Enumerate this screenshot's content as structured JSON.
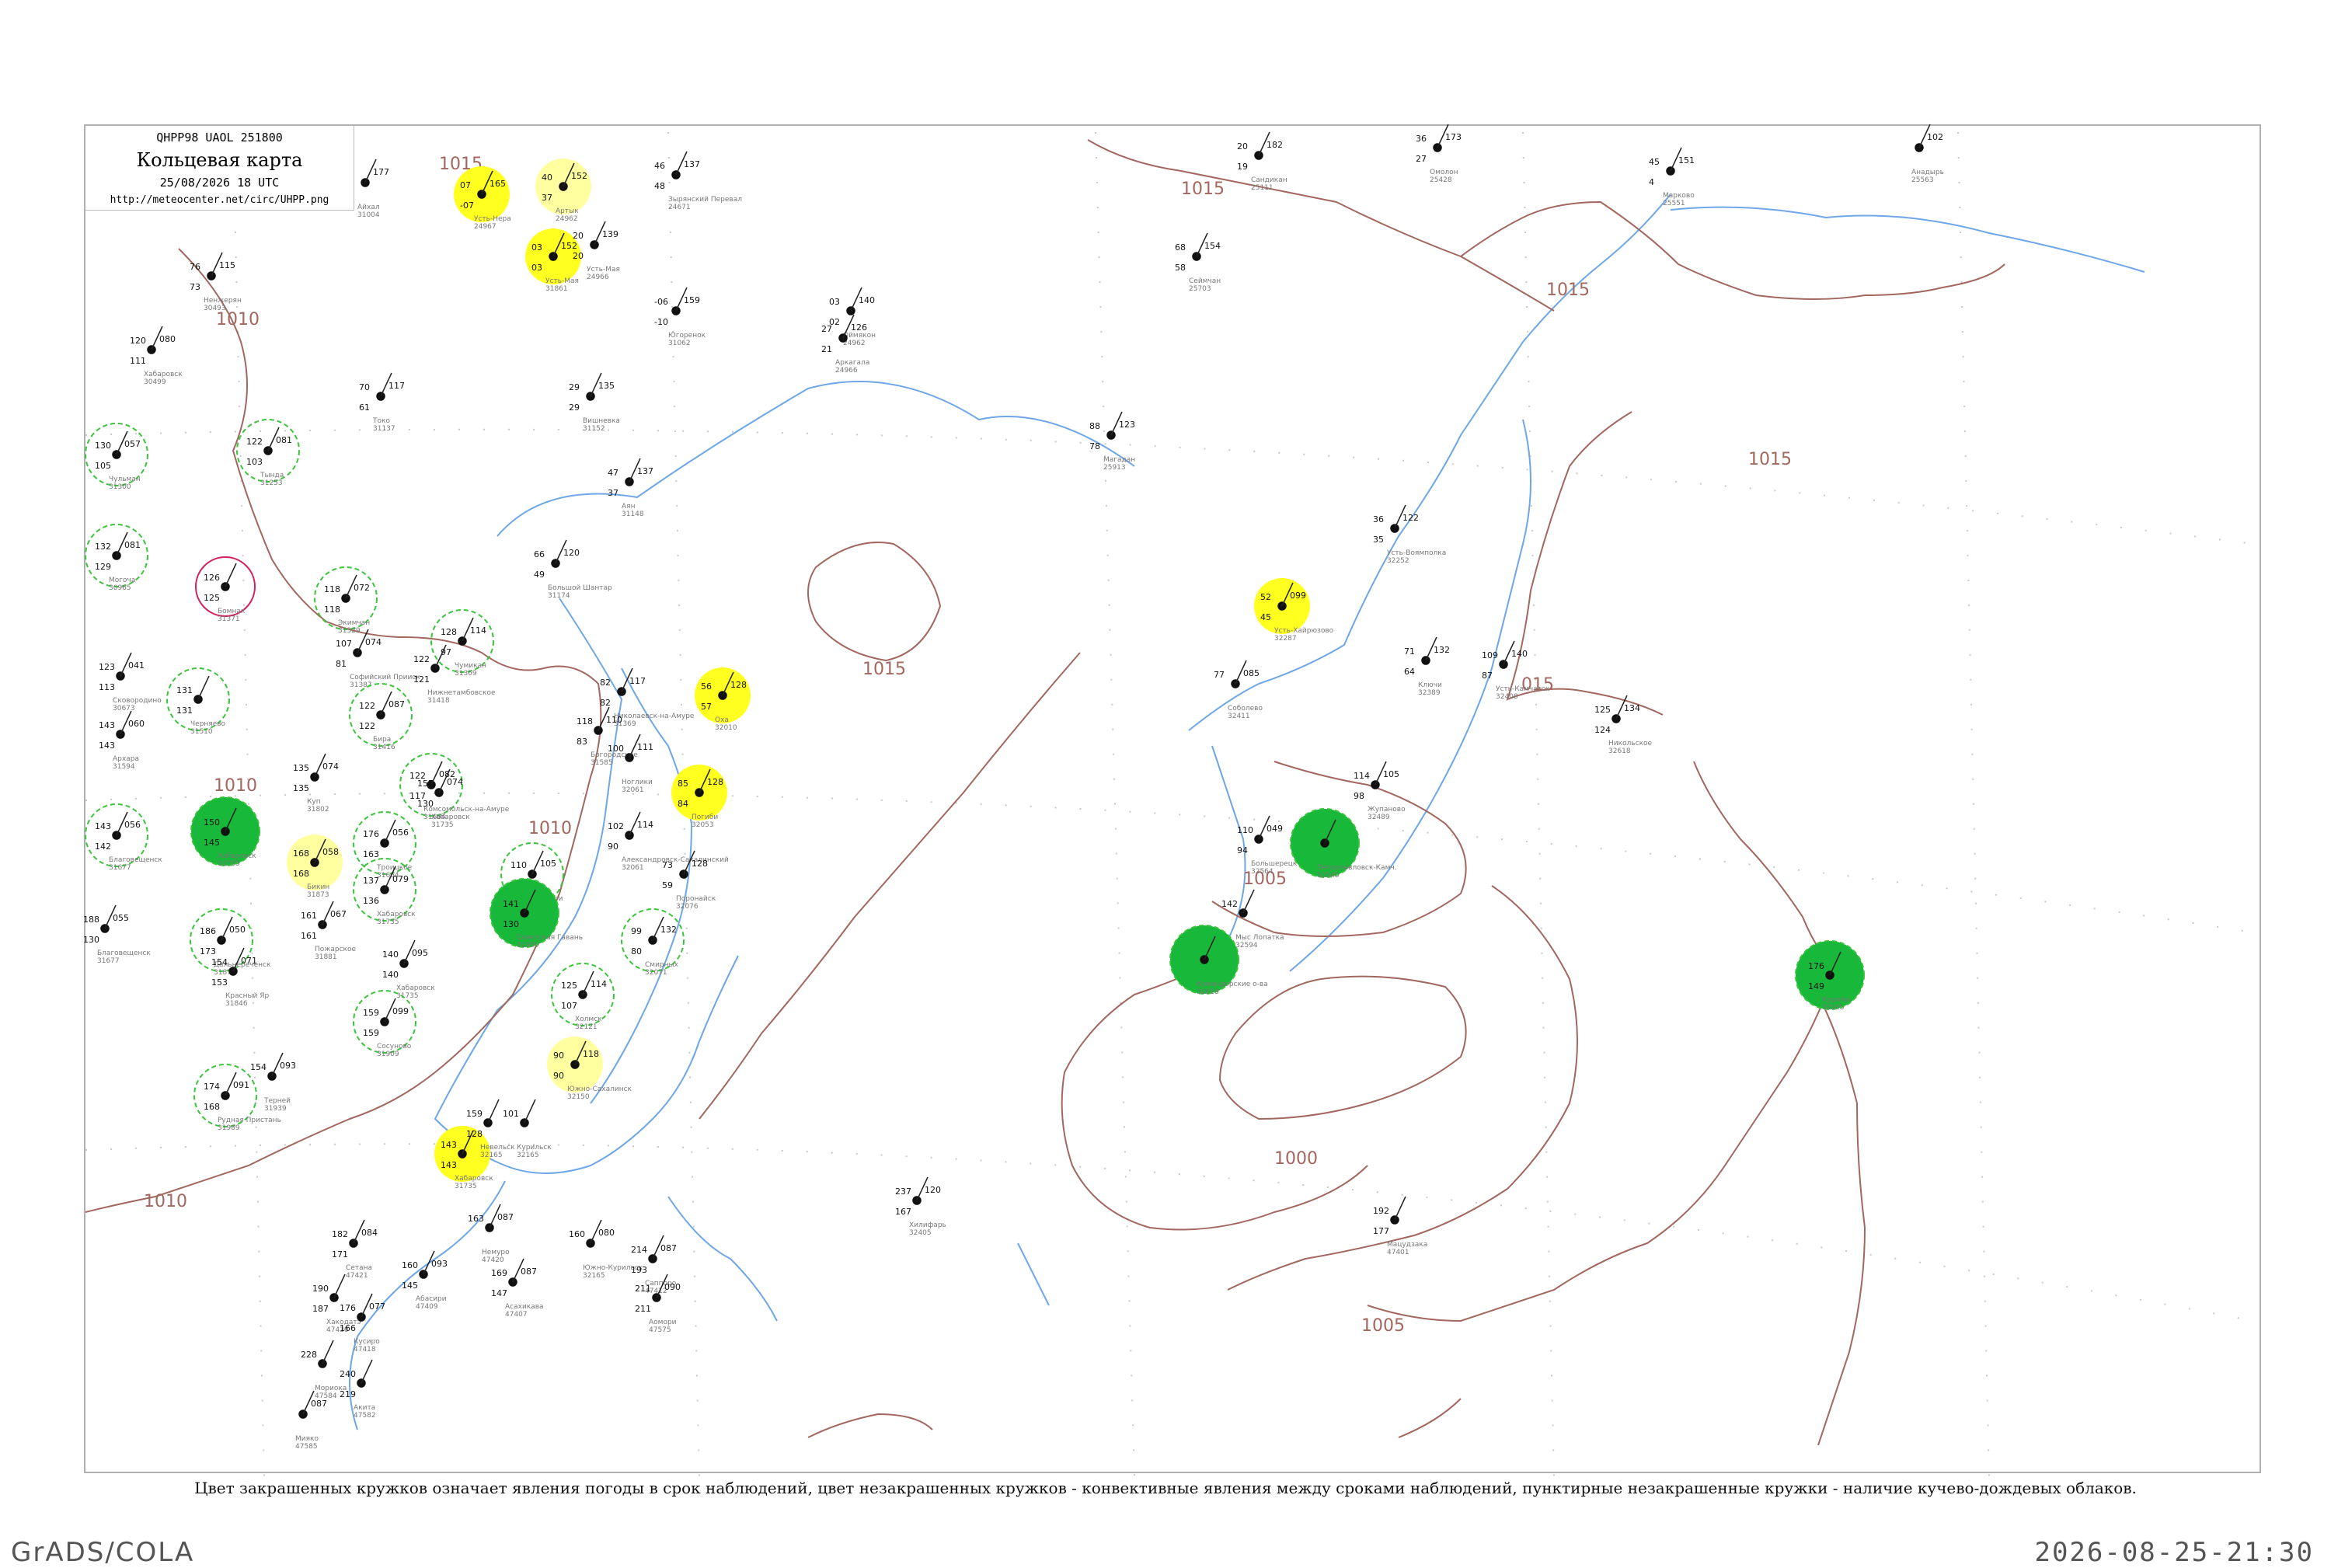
{
  "header": {
    "code": "QHPP98  UAOL  251800",
    "title": "Кольцевая карта",
    "datetime": "25/08/2026 18 UTC",
    "url": "http://meteocenter.net/circ/UHPP.png"
  },
  "caption": "Цвет закрашенных кружков означает явления погоды в срок наблюдений, цвет незакрашенных кружков - конвективные явления между сроками наблюдений, пунктирные незакрашенные кружки - наличие кучево-дождевых облаков.",
  "footer": {
    "left": "GrADS/COLA",
    "right": "2026-08-25-21:30"
  },
  "colors": {
    "isobar": "#a2675e",
    "coast": "#6ea6e8",
    "green_fill": "#18b83a",
    "yellow_fill": "#ffff20",
    "pale_yellow_fill": "#ffffa0",
    "red_fill": "#e8305a",
    "dashed_ring": "#3cc33c",
    "pink_ring": "#d02060"
  },
  "isobars": [
    {
      "label": "1015"
    },
    {
      "label": "1015"
    },
    {
      "label": "1015"
    },
    {
      "label": "1015"
    },
    {
      "label": "1015"
    },
    {
      "label": "1010"
    },
    {
      "label": "1010"
    },
    {
      "label": "1010"
    },
    {
      "label": "1010"
    },
    {
      "label": "1005"
    },
    {
      "label": "1005"
    },
    {
      "label": "1000"
    },
    {
      "label": "015"
    }
  ],
  "stations": [
    {
      "temp": "20",
      "pres": "182",
      "dew": "19",
      "name": "Сандикан",
      "id": "25111"
    },
    {
      "temp": "36",
      "pres": "173",
      "dew": "27",
      "name": "Омолон",
      "id": "25428"
    },
    {
      "temp": "45",
      "pres": "151",
      "dew": "4",
      "name": "Марково",
      "id": "25551"
    },
    {
      "temp": "",
      "pres": "102",
      "dew": "",
      "name": "Анадырь",
      "id": "25563"
    },
    {
      "temp": "46",
      "pres": "137",
      "dew": "48",
      "name": "Зырянский Перевал",
      "id": "24671"
    },
    {
      "temp": "68",
      "pres": "154",
      "dew": "58",
      "name": "Сеймчан",
      "id": "25703"
    },
    {
      "temp": "88",
      "pres": "123",
      "dew": "78",
      "name": "Магадан",
      "id": "25913"
    },
    {
      "temp": "04",
      "pres": "177",
      "dew": "01",
      "name": "Айхал",
      "id": "31004"
    },
    {
      "temp": "07",
      "pres": "165",
      "dew": "-07",
      "name": "Усть-Нера",
      "id": "24967"
    },
    {
      "temp": "40",
      "pres": "152",
      "dew": "37",
      "name": "Артык",
      "id": "24962"
    },
    {
      "temp": "03",
      "pres": "152",
      "dew": "03",
      "name": "Усть-Мая",
      "id": "31861"
    },
    {
      "temp": "20",
      "pres": "139",
      "dew": "20",
      "name": "Усть-Мая",
      "id": "24966"
    },
    {
      "temp": "76",
      "pres": "115",
      "dew": "73",
      "name": "Ненжерян",
      "id": "30493"
    },
    {
      "temp": "120",
      "pres": "080",
      "dew": "111",
      "name": "Хабаровск",
      "id": "30499"
    },
    {
      "temp": "03",
      "pres": "140",
      "dew": "02",
      "name": "Оймякон",
      "id": "24962"
    },
    {
      "temp": "27",
      "pres": "126",
      "dew": "21",
      "name": "Аркагала",
      "id": "24966"
    },
    {
      "temp": "-06",
      "pres": "159",
      "dew": "-10",
      "name": "Югоренок",
      "id": "31062"
    },
    {
      "temp": "70",
      "pres": "117",
      "dew": "61",
      "name": "Токо",
      "id": "31137"
    },
    {
      "temp": "29",
      "pres": "135",
      "dew": "29",
      "name": "Вишневка",
      "id": "31152"
    },
    {
      "temp": "130",
      "pres": "057",
      "dew": "105",
      "name": "Чульман",
      "id": "31300"
    },
    {
      "temp": "122",
      "pres": "081",
      "dew": "103",
      "name": "Тында",
      "id": "31253"
    },
    {
      "temp": "47",
      "pres": "137",
      "dew": "37",
      "name": "Аян",
      "id": "31148"
    },
    {
      "temp": "132",
      "pres": "081",
      "dew": "129",
      "name": "Могоча",
      "id": "30965"
    },
    {
      "temp": "126",
      "pres": "",
      "dew": "125",
      "name": "Бомнак",
      "id": "31371"
    },
    {
      "temp": "118",
      "pres": "072",
      "dew": "118",
      "name": "Экимчан",
      "id": "31329"
    },
    {
      "temp": "66",
      "pres": "120",
      "dew": "49",
      "name": "Большой Шантар",
      "id": "31174"
    },
    {
      "temp": "128",
      "pres": "114",
      "dew": "97",
      "name": "Чумикан",
      "id": "31369"
    },
    {
      "temp": "123",
      "pres": "041",
      "dew": "113",
      "name": "Сковородино",
      "id": "30673"
    },
    {
      "temp": "107",
      "pres": "074",
      "dew": "81",
      "name": "Софийский Прииск",
      "id": "31387"
    },
    {
      "temp": "131",
      "pres": "",
      "dew": "131",
      "name": "Черняево",
      "id": "31510"
    },
    {
      "temp": "143",
      "pres": "060",
      "dew": "143",
      "name": "Архара",
      "id": "31594"
    },
    {
      "temp": "122",
      "pres": "087",
      "dew": "122",
      "name": "Бира",
      "id": "31416"
    },
    {
      "temp": "122",
      "pres": "",
      "dew": "121",
      "name": "Нижнетамбовское",
      "id": "31418"
    },
    {
      "temp": "82",
      "pres": "117",
      "dew": "82",
      "name": "Николаевск-на-Амуре",
      "id": "31369"
    },
    {
      "temp": "56",
      "pres": "128",
      "dew": "57",
      "name": "Оха",
      "id": "32010"
    },
    {
      "temp": "118",
      "pres": "110",
      "dew": "83",
      "name": "Богородское",
      "id": "31585"
    },
    {
      "temp": "100",
      "pres": "111",
      "dew": "",
      "name": "Ноглики",
      "id": "32061"
    },
    {
      "temp": "85",
      "pres": "128",
      "dew": "84",
      "name": "Погиби",
      "id": "32053"
    },
    {
      "temp": "135",
      "pres": "074",
      "dew": "135",
      "name": "Куп",
      "id": "31802"
    },
    {
      "temp": "122",
      "pres": "082",
      "dew": "117",
      "name": "Комсомольск-на-Амуре",
      "id": "31664"
    },
    {
      "temp": "157",
      "pres": "074",
      "dew": "130",
      "name": "Хабаровск",
      "id": "31735"
    },
    {
      "temp": "143",
      "pres": "056",
      "dew": "142",
      "name": "Благовещенск",
      "id": "31677"
    },
    {
      "temp": "150",
      "pres": "",
      "dew": "145",
      "name": "Хабаровск",
      "id": "31735"
    },
    {
      "temp": "168",
      "pres": "058",
      "dew": "168",
      "name": "Бикин",
      "id": "31873"
    },
    {
      "temp": "176",
      "pres": "056",
      "dew": "163",
      "name": "Троицкое",
      "id": "31664"
    },
    {
      "temp": "137",
      "pres": "079",
      "dew": "136",
      "name": "Хабаровск",
      "id": "31735"
    },
    {
      "temp": "110",
      "pres": "105",
      "dew": "",
      "name": "Де-Кастри",
      "id": "31545"
    },
    {
      "temp": "141",
      "pres": "",
      "dew": "130",
      "name": "Советская Гавань",
      "id": "31959"
    },
    {
      "temp": "102",
      "pres": "114",
      "dew": "90",
      "name": "Александровск-Сахалинский",
      "id": "32061"
    },
    {
      "temp": "73",
      "pres": "128",
      "dew": "59",
      "name": "Поронайск",
      "id": "32076"
    },
    {
      "temp": "188",
      "pres": "055",
      "dew": "130",
      "name": "Благовещенск",
      "id": "31677"
    },
    {
      "temp": "161",
      "pres": "067",
      "dew": "161",
      "name": "Пожарское",
      "id": "31881"
    },
    {
      "temp": "186",
      "pres": "050",
      "dew": "173",
      "name": "Дальнереченск",
      "id": "31873"
    },
    {
      "temp": "154",
      "pres": "071",
      "dew": "153",
      "name": "Красный Яр",
      "id": "31846"
    },
    {
      "temp": "140",
      "pres": "095",
      "dew": "140",
      "name": "Хабаровск",
      "id": "31735"
    },
    {
      "temp": "99",
      "pres": "132",
      "dew": "80",
      "name": "Смирных",
      "id": "32071"
    },
    {
      "temp": "125",
      "pres": "114",
      "dew": "107",
      "name": "Холмск",
      "id": "32121"
    },
    {
      "temp": "90",
      "pres": "118",
      "dew": "90",
      "name": "Южно-Сахалинск",
      "id": "32150"
    },
    {
      "temp": "159",
      "pres": "099",
      "dew": "159",
      "name": "Сосуново",
      "id": "31909"
    },
    {
      "temp": "174",
      "pres": "091",
      "dew": "168",
      "name": "Рудная Пристань",
      "id": "31989"
    },
    {
      "temp": "154",
      "pres": "093",
      "dew": "",
      "name": "Терней",
      "id": "31939"
    },
    {
      "temp": "143",
      "pres": "",
      "dew": "143",
      "name": "Хабаровск",
      "id": "31735"
    },
    {
      "temp": "159",
      "pres": "",
      "dew": "128",
      "name": "Невельск",
      "id": "32165"
    },
    {
      "temp": "101",
      "pres": "",
      "dew": "",
      "name": "Курильск",
      "id": "32165"
    },
    {
      "temp": "52",
      "pres": "099",
      "dew": "45",
      "name": "Усть-Хайрюзово",
      "id": "32287"
    },
    {
      "temp": "36",
      "pres": "122",
      "dew": "35",
      "name": "Усть-Воямполка",
      "id": "32252"
    },
    {
      "temp": "71",
      "pres": "132",
      "dew": "64",
      "name": "Ключи",
      "id": "32389"
    },
    {
      "temp": "109",
      "pres": "140",
      "dew": "87",
      "name": "Усть-Камчатск",
      "id": "32408"
    },
    {
      "temp": "125",
      "pres": "134",
      "dew": "124",
      "name": "Никольское",
      "id": "32618"
    },
    {
      "temp": "77",
      "pres": "085",
      "dew": "",
      "name": "Соболево",
      "id": "32411"
    },
    {
      "temp": "114",
      "pres": "105",
      "dew": "98",
      "name": "Жупаново",
      "id": "32489"
    },
    {
      "temp": "110",
      "pres": "049",
      "dew": "94",
      "name": "Большерецк",
      "id": "32564"
    },
    {
      "temp": "",
      "pres": "",
      "dew": "",
      "name": "Петропавловск-Камч.",
      "id": "32540"
    },
    {
      "temp": "142",
      "pres": "",
      "dew": "",
      "name": "Мыс Лопатка",
      "id": "32594"
    },
    {
      "temp": "",
      "pres": "",
      "dew": "",
      "name": "Командорские о-ва",
      "id": "32618"
    },
    {
      "temp": "176",
      "pres": "",
      "dew": "149",
      "name": "Курилы",
      "id": "32165"
    },
    {
      "temp": "237",
      "pres": "120",
      "dew": "167",
      "name": "Хилифарь",
      "id": "32405"
    },
    {
      "temp": "192",
      "pres": "",
      "dew": "177",
      "name": "Мацудзака",
      "id": "47401"
    },
    {
      "temp": "182",
      "pres": "084",
      "dew": "171",
      "name": "Сетана",
      "id": "47421"
    },
    {
      "temp": "160",
      "pres": "093",
      "dew": "145",
      "name": "Абасири",
      "id": "47409"
    },
    {
      "temp": "163",
      "pres": "087",
      "dew": "",
      "name": "Немуро",
      "id": "47420"
    },
    {
      "temp": "169",
      "pres": "087",
      "dew": "147",
      "name": "Асахикава",
      "id": "47407"
    },
    {
      "temp": "160",
      "pres": "080",
      "dew": "",
      "name": "Южно-Курильск",
      "id": "32165"
    },
    {
      "temp": "214",
      "pres": "087",
      "dew": "193",
      "name": "Саппоро",
      "id": "47412"
    },
    {
      "temp": "190",
      "pres": "",
      "dew": "187",
      "name": "Хакодатэ",
      "id": "47430"
    },
    {
      "temp": "176",
      "pres": "077",
      "dew": "166",
      "name": "Кусиро",
      "id": "47418"
    },
    {
      "temp": "211",
      "pres": "090",
      "dew": "211",
      "name": "Аомори",
      "id": "47575"
    },
    {
      "temp": "228",
      "pres": "",
      "dew": "",
      "name": "Мориока",
      "id": "47584"
    },
    {
      "temp": "240",
      "pres": "",
      "dew": "219",
      "name": "Акита",
      "id": "47582"
    },
    {
      "temp": "",
      "pres": "087",
      "dew": "",
      "name": "Мияко",
      "id": "47585"
    }
  ]
}
